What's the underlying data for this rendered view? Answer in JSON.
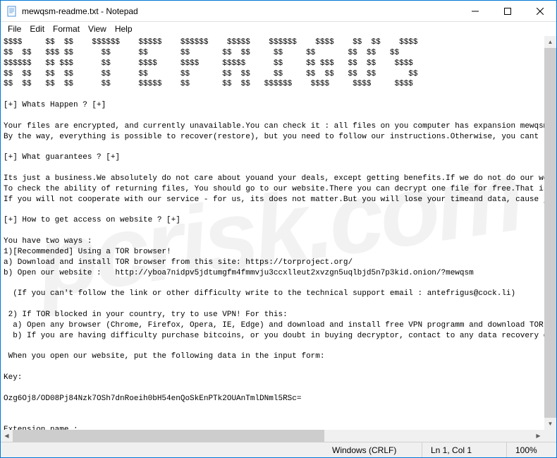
{
  "window": {
    "title": "mewqsm-readme.txt - Notepad"
  },
  "menu": {
    "file": "File",
    "edit": "Edit",
    "format": "Format",
    "view": "View",
    "help": "Help"
  },
  "content": {
    "text": "$$$$     $$  $$    $$$$$$    $$$$$    $$$$$$    $$$$$    $$$$$$    $$$$    $$  $$    $$$$\n$$  $$   $$$ $$      $$      $$       $$       $$  $$     $$     $$       $$  $$   $$\n$$$$$$   $$ $$$      $$      $$$$     $$$$     $$$$$      $$     $$ $$$   $$  $$    $$$$\n$$  $$   $$  $$      $$      $$       $$       $$  $$     $$     $$  $$   $$  $$       $$\n$$  $$   $$  $$      $$      $$$$$    $$       $$  $$   $$$$$$    $$$$     $$$$     $$$$\n\n[+] Whats Happen ? [+]\n\nYour files are encrypted, and currently unavailable.You can check it : all files on you computer has expansion mewqsm.\nBy the way, everything is possible to recover(restore), but you need to follow our instructions.Otherwise, you cant re\n\n[+] What guarantees ? [+]\n\nIts just a business.We absolutely do not care about youand your deals, except getting benefits.If we do not do our wor\nTo check the ability of returning files, You should go to our website.There you can decrypt one file for free.That is \nIf you will not cooperate with our service - for us, its does not matter.But you will lose your timeand data, cause ju\n\n[+] How to get access on website ? [+]\n\nYou have two ways :\n1)[Recommended] Using a TOR browser!\na) Download and install TOR browser from this site: https://torproject.org/\nb) Open our website :   http://yboa7nidpv5jdtumgfm4fmmvju3ccxlleut2xvzgn5uqlbjd5n7p3kid.onion/?mewqsm\n\n  (If you can't follow the link or other difficulty write to the technical support email : antefrigus@cock.li)\n\n 2) If TOR blocked in your country, try to use VPN! For this:\n  a) Open any browser (Chrome, Firefox, Opera, IE, Edge) and download and install free VPN programm and download TOR br\n  b) If you are having difficulty purchase bitcoins, or you doubt in buying decryptor, contact to any data recovery co\n\n When you open our website, put the following data in the input form:\n\nKey:\n\nOzg6Oj8/OD08Pj84Nzk7OSh7dnRoeih0bH54enQoSkEnPTk2OUAnTmlDNml5RSc=\n\n\nExtension name :\n\n\nmewqsm"
  },
  "status": {
    "encoding": "Windows (CRLF)",
    "position": "Ln 1, Col 1",
    "zoom": "100%"
  },
  "watermark": "pcrisk.com"
}
